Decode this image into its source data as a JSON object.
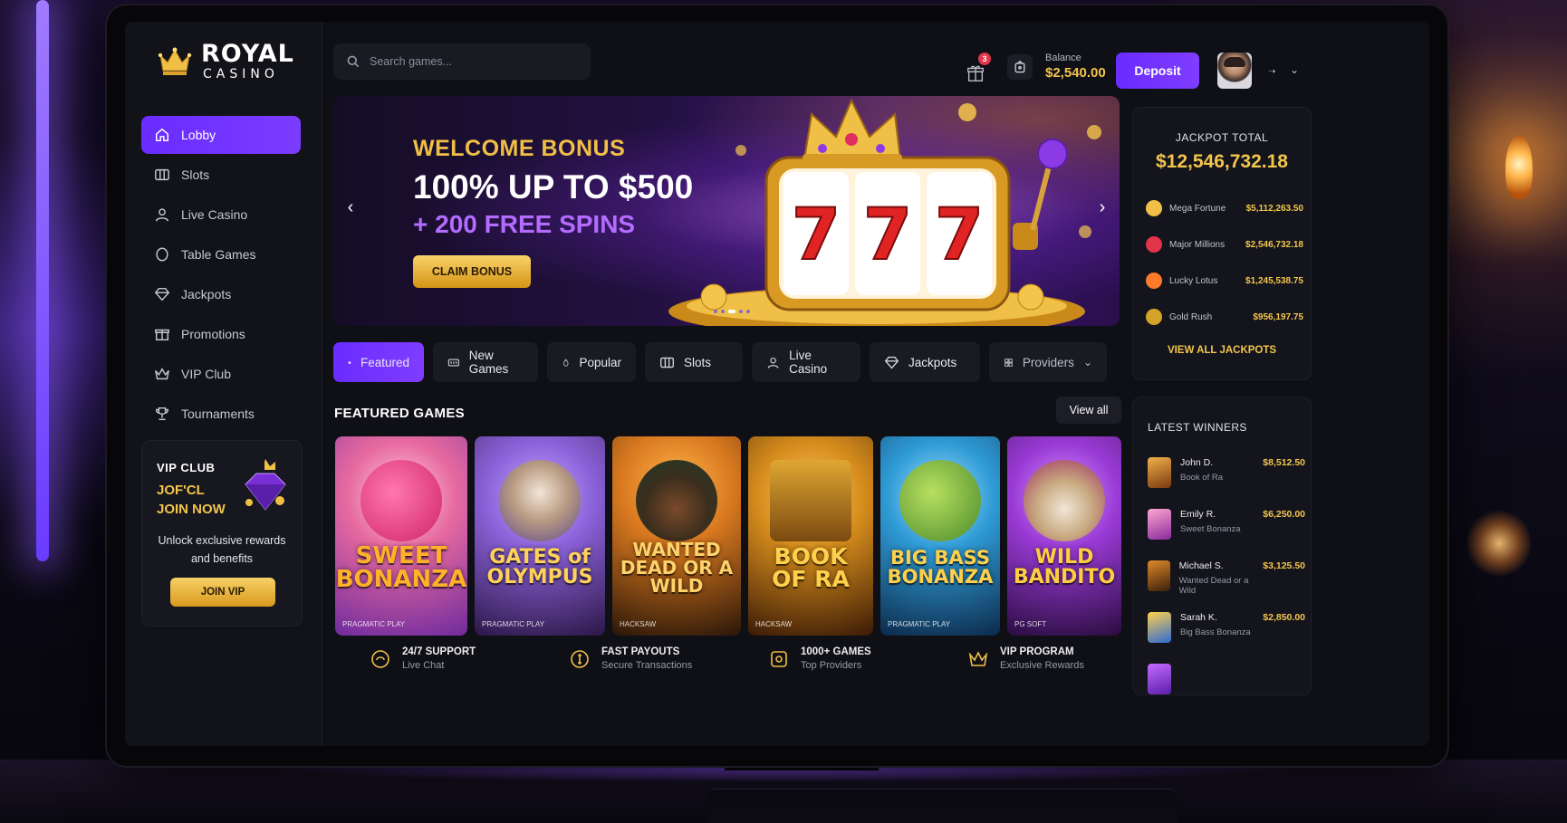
{
  "brand": {
    "name": "ROYAL",
    "sub": "CASINO",
    "gold": "#f3c54b",
    "purple": "#7b3cff"
  },
  "sidebar": {
    "items": [
      {
        "label": "Lobby",
        "icon": "home-icon",
        "active": true
      },
      {
        "label": "Slots",
        "icon": "slots-icon"
      },
      {
        "label": "Live Casino",
        "icon": "user-icon"
      },
      {
        "label": "Table Games",
        "icon": "chip-icon"
      },
      {
        "label": "Jackpots",
        "icon": "diamond-icon"
      },
      {
        "label": "Promotions",
        "icon": "gift-icon"
      },
      {
        "label": "VIP Club",
        "icon": "crown-icon"
      },
      {
        "label": "Tournaments",
        "icon": "trophy-icon"
      }
    ],
    "vip": {
      "title": "VIP CLUB",
      "line1": "JOF'CL",
      "line2": "JOIN NOW",
      "desc": "Unlock exclusive rewards and benefits",
      "button": "JOIN VIP"
    }
  },
  "header": {
    "search_placeholder": "Search games...",
    "gift_badge": "3",
    "balance_label": "Balance",
    "balance_value": "$2,540.00",
    "deposit_label": "Deposit"
  },
  "hero": {
    "eyebrow": "WELCOME BONUS",
    "title": "100% UP TO $500",
    "spins": "+ 200 FREE SPINS",
    "cta": "CLAIM BONUS"
  },
  "tabs": [
    {
      "label": "Featured",
      "icon": "star-icon",
      "active": true
    },
    {
      "label": "New Games",
      "icon": "new-icon"
    },
    {
      "label": "Popular",
      "icon": "flame-icon"
    },
    {
      "label": "Slots",
      "icon": "slots-icon"
    },
    {
      "label": "Live Casino",
      "icon": "user-icon"
    },
    {
      "label": "Jackpots",
      "icon": "diamond-icon"
    },
    {
      "label": "Providers",
      "icon": "grid-icon"
    }
  ],
  "featured": {
    "title": "FEATURED GAMES",
    "view_all": "View all",
    "games": [
      {
        "name": "SWEET BONANZA",
        "brand": "PRAGMATIC PLAY",
        "bg": "#e76aa0",
        "bg2": "#6f2b9d",
        "text": "#ffb12a"
      },
      {
        "name": "GATES of OLYMPUS",
        "brand": "PRAGMATIC PLAY",
        "bg": "#8b62d9",
        "bg2": "#2b1746",
        "text": "#ffd05a"
      },
      {
        "name": "WANTED DEAD OR A WILD",
        "brand": "HACKSAW",
        "bg": "#d8781f",
        "bg2": "#2a1608",
        "text": "#ffd36a"
      },
      {
        "name": "BOOK OF RA",
        "brand": "HACKSAW",
        "bg": "#d58c1c",
        "bg2": "#3a1a06",
        "text": "#ffd04b"
      },
      {
        "name": "BIG BASS BONANZA",
        "brand": "PRAGMATIC PLAY",
        "bg": "#2f9bd6",
        "bg2": "#0c2a4a",
        "text": "#ffd04b"
      },
      {
        "name": "WILD BANDITO",
        "brand": "PG SOFT",
        "bg": "#9a3ad6",
        "bg2": "#2a0d40",
        "text": "#ffcd42"
      }
    ]
  },
  "features": [
    {
      "title": "24/7 SUPPORT",
      "sub": "Live Chat",
      "icon": "support-icon"
    },
    {
      "title": "FAST PAYOUTS",
      "sub": "Secure Transactions",
      "icon": "payout-icon"
    },
    {
      "title": "1000+ GAMES",
      "sub": "Top Providers",
      "icon": "games-icon"
    },
    {
      "title": "VIP PROGRAM",
      "sub": "Exclusive Rewards",
      "icon": "crown-icon"
    }
  ],
  "jackpot": {
    "label": "JACKPOT TOTAL",
    "total": "$12,546,732.18",
    "rows": [
      {
        "name": "Mega Fortune",
        "value": "$5,112,263.50",
        "color": "#f0bf46"
      },
      {
        "name": "Major Millions",
        "value": "$2,546,732.18",
        "color": "#e2344a"
      },
      {
        "name": "Lucky Lotus",
        "value": "$1,245,538.75",
        "color": "#ff7a2a"
      },
      {
        "name": "Gold Rush",
        "value": "$956,197.75",
        "color": "#d4a42a"
      }
    ],
    "view_all": "VIEW ALL JACKPOTS"
  },
  "winners": {
    "title": "LATEST WINNERS",
    "rows": [
      {
        "name": "John D.",
        "game": "Book of Ra",
        "amount": "$8,512.50",
        "color": "#c8741d"
      },
      {
        "name": "Emily R.",
        "game": "Sweet Bonanza",
        "amount": "$6,250.00",
        "color": "#e76aa0"
      },
      {
        "name": "Michael S.",
        "game": "Wanted Dead or a Wild",
        "amount": "$3,125.50",
        "color": "#b5581a"
      },
      {
        "name": "Sarah K.",
        "game": "Big Bass Bonanza",
        "amount": "$2,850.00",
        "color": "#2f9bd6"
      }
    ]
  }
}
